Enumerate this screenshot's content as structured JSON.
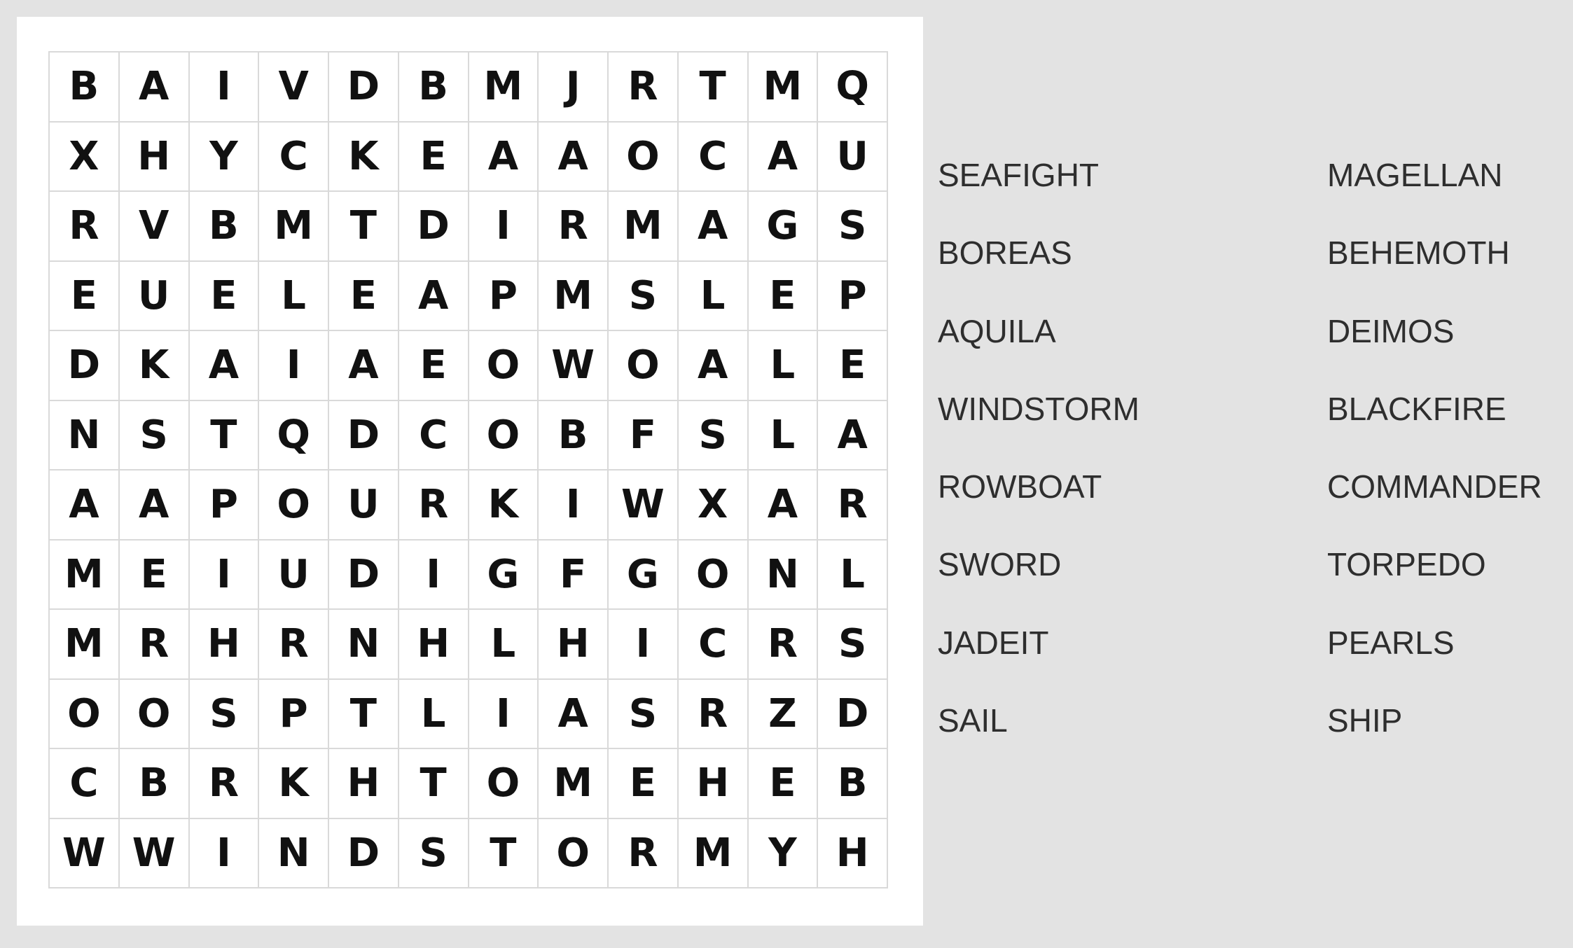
{
  "puzzle": {
    "grid": [
      [
        "B",
        "A",
        "I",
        "V",
        "D",
        "B",
        "M",
        "J",
        "R",
        "T",
        "M",
        "Q"
      ],
      [
        "X",
        "H",
        "Y",
        "C",
        "K",
        "E",
        "A",
        "A",
        "O",
        "C",
        "A",
        "U"
      ],
      [
        "R",
        "V",
        "B",
        "M",
        "T",
        "D",
        "I",
        "R",
        "M",
        "A",
        "G",
        "S"
      ],
      [
        "E",
        "U",
        "E",
        "L",
        "E",
        "A",
        "P",
        "M",
        "S",
        "L",
        "E",
        "P"
      ],
      [
        "D",
        "K",
        "A",
        "I",
        "A",
        "E",
        "O",
        "W",
        "O",
        "A",
        "L",
        "E"
      ],
      [
        "N",
        "S",
        "T",
        "Q",
        "D",
        "C",
        "O",
        "B",
        "F",
        "S",
        "L",
        "A"
      ],
      [
        "A",
        "A",
        "P",
        "O",
        "U",
        "R",
        "K",
        "I",
        "W",
        "X",
        "A",
        "R"
      ],
      [
        "M",
        "E",
        "I",
        "U",
        "D",
        "I",
        "G",
        "F",
        "G",
        "O",
        "N",
        "L"
      ],
      [
        "M",
        "R",
        "H",
        "R",
        "N",
        "H",
        "L",
        "H",
        "I",
        "C",
        "R",
        "S"
      ],
      [
        "O",
        "O",
        "S",
        "P",
        "T",
        "L",
        "I",
        "A",
        "S",
        "R",
        "Z",
        "D"
      ],
      [
        "C",
        "B",
        "R",
        "K",
        "H",
        "T",
        "O",
        "M",
        "E",
        "H",
        "E",
        "B"
      ],
      [
        "W",
        "W",
        "I",
        "N",
        "D",
        "S",
        "T",
        "O",
        "R",
        "M",
        "Y",
        "H"
      ]
    ]
  },
  "word_list": {
    "rows": [
      [
        "SEAFIGHT",
        "MAGELLAN"
      ],
      [
        "BOREAS",
        "BEHEMOTH"
      ],
      [
        "AQUILA",
        "DEIMOS"
      ],
      [
        "WINDSTORM",
        "BLACKFIRE"
      ],
      [
        "ROWBOAT",
        "COMMANDER"
      ],
      [
        "SWORD",
        "TORPEDO"
      ],
      [
        "JADEIT",
        "PEARLS"
      ],
      [
        "SAIL",
        "SHIP"
      ]
    ]
  },
  "colors": {
    "background": "#e3e3e3",
    "panel": "#ffffff",
    "grid_line": "#d9d9d9",
    "letter": "#111111",
    "word": "#2e2e2e"
  }
}
